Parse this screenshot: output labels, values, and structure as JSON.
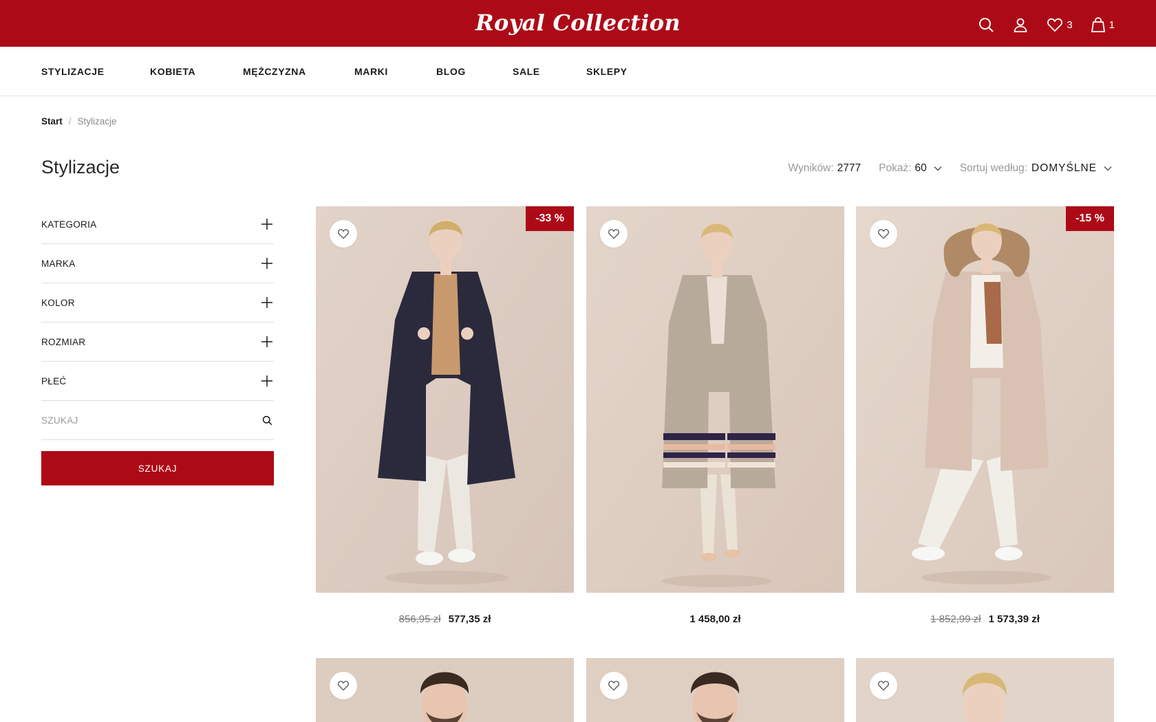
{
  "brand": {
    "logo": "Royal Collection",
    "color": "#ad0a17"
  },
  "header": {
    "wishlist_count": "3",
    "cart_count": "1"
  },
  "nav": {
    "items": [
      "STYLIZACJE",
      "KOBIETA",
      "MĘŻCZYZNA",
      "MARKI",
      "BLOG",
      "SALE",
      "SKLEPY"
    ]
  },
  "breadcrumb": {
    "start": "Start",
    "separator": "/",
    "current": "Stylizacje"
  },
  "page": {
    "title": "Stylizacje",
    "results_label": "Wyników:",
    "results_value": "2777",
    "show_label": "Pokaż:",
    "show_value": "60",
    "sort_label": "Sortuj według:",
    "sort_value": "DOMYŚLNE"
  },
  "filters": {
    "items": [
      "KATEGORIA",
      "MARKA",
      "KOLOR",
      "ROZMIAR",
      "PŁEĆ"
    ],
    "search_placeholder": "SZUKAJ",
    "search_button": "SZUKAJ"
  },
  "products": [
    {
      "badge": "-33 %",
      "old_price": "856,95 zł",
      "price": "577,35 zł",
      "coat_color": "#2b2a3d"
    },
    {
      "badge": "",
      "old_price": "",
      "price": "1 458,00 zł",
      "coat_color": "#b8aa9b"
    },
    {
      "badge": "-15 %",
      "old_price": "1 852,99 zł",
      "price": "1 573,39 zł",
      "coat_color": "#d9c2b4"
    },
    {
      "badge": "",
      "old_price": "",
      "price": ""
    },
    {
      "badge": "",
      "old_price": "",
      "price": ""
    },
    {
      "badge": "",
      "old_price": "",
      "price": ""
    }
  ],
  "icons": {
    "search": "search-icon",
    "account": "user-icon",
    "wishlist": "heart-icon",
    "cart": "shopping-bag-icon",
    "expand": "plus-icon",
    "dropdown": "chevron-down-icon"
  }
}
